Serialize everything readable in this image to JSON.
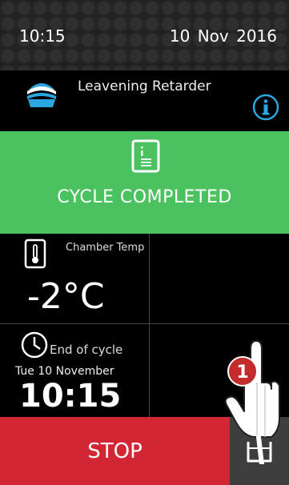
{
  "status": {
    "time": "10:15",
    "date": "10 Nov 2016"
  },
  "device": {
    "name": "Leavening Retarder",
    "icon": "retarder-icon",
    "info_icon": "info-icon"
  },
  "cycle": {
    "status": "CYCLE COMPLETED",
    "icon": "recipe-icon",
    "color": "#4bc160"
  },
  "chamber": {
    "label": "Chamber Temp",
    "value": "-2°C",
    "icon": "thermometer-icon"
  },
  "end_of_cycle": {
    "label": "End of cycle",
    "date": "Tue 10 November",
    "time": "10:15",
    "icon": "clock-icon"
  },
  "actions": {
    "stop_label": "STOP",
    "stop_color": "#d32635",
    "side_icon": "box-icon"
  },
  "hint": {
    "step": "1",
    "icon": "pointing-hand-icon"
  }
}
